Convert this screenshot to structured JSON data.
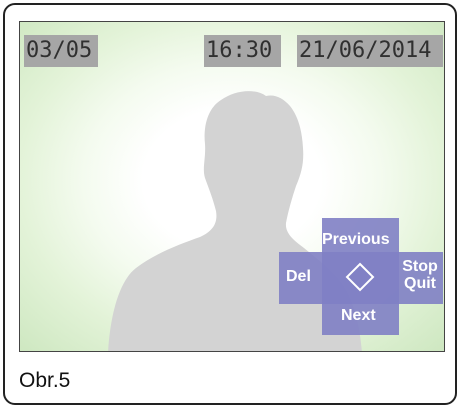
{
  "osd": {
    "counter": "03/05",
    "time": "16:30",
    "date": "21/06/2014"
  },
  "navigation": {
    "previous_label": "Previous",
    "next_label": "Next",
    "delete_label": "Del",
    "stop_label": "Stop",
    "quit_label": "Quit",
    "center_icon": "diamond-select-icon"
  },
  "caption": "Obr.5",
  "colors": {
    "osd_background": "#a6a6a6",
    "osd_text": "#303030",
    "pad": "#8080c4",
    "silhouette": "#d3d3d3",
    "screen_vignette": "#cfe8c2"
  }
}
